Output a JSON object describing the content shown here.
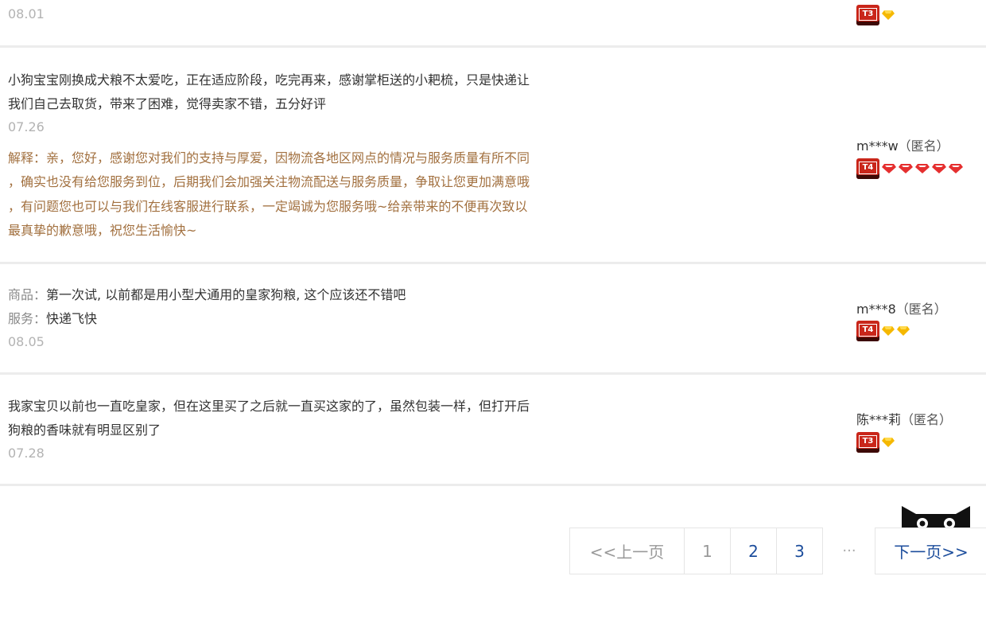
{
  "reviews": [
    {
      "date": "08.01",
      "badge": "T3"
    },
    {
      "lines": [
        "小狗宝宝刚换成犬粮不太爱吃，正在适应阶段，吃完再来，感谢掌柜送的小耙梳，只是快递让",
        "我们自己去取货，带来了困难，觉得卖家不错，五分好评"
      ],
      "date": "07.26",
      "reply": [
        "解释：亲，您好，感谢您对我们的支持与厚爱，因物流各地区网点的情况与服务质量有所不同",
        "，确实也没有给您服务到位，后期我们会加强关注物流配送与服务质量，争取让您更加满意哦",
        "，有问题您也可以与我们在线客服进行联系，一定竭诚为您服务哦~给亲带来的不便再次致以",
        "最真挚的歉意哦，祝您生活愉快~"
      ],
      "user": "m***w",
      "anon": "（匿名）",
      "badge": "T4"
    },
    {
      "goods_label": "商品：",
      "goods_text": "第一次试, 以前都是用小型犬通用的皇家狗粮, 这个应该还不错吧",
      "service_label": "服务：",
      "service_text": "快递飞快",
      "date": "08.05",
      "user": "m***8",
      "anon": "（匿名）",
      "badge": "T4"
    },
    {
      "lines": [
        "我家宝贝以前也一直吃皇家，但在这里买了之后就一直买这家的了，虽然包装一样，但打开后",
        "狗粮的香味就有明显区别了"
      ],
      "date": "07.28",
      "user": "陈***莉",
      "anon": "（匿名）",
      "badge": "T3"
    }
  ],
  "pagination": {
    "prev": "<<上一页",
    "pages": [
      "1",
      "2",
      "3"
    ],
    "ellipsis": "···",
    "next": "下一页>>"
  },
  "colors": {
    "reply": "#a2703f",
    "date": "#b3b3b3",
    "link": "#1c4d9c",
    "badge_red": "#c9261a",
    "gem_yellow": "#f5b800",
    "gem_red": "#e52f2f"
  }
}
